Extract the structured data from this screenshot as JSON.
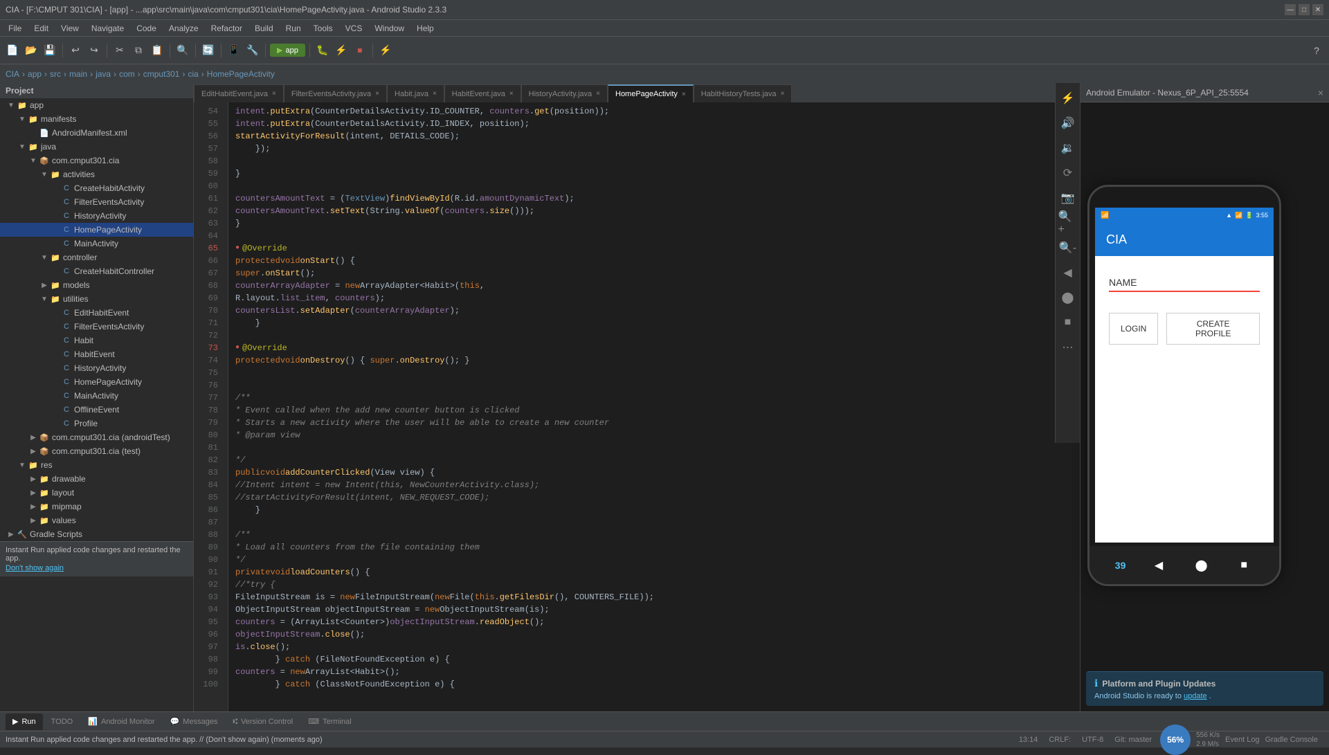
{
  "titleBar": {
    "text": "CIA - [F:\\CMPUT 301\\CIA] - [app] - ...app\\src\\main\\java\\com\\cmput301\\cia\\HomePageActivity.java - Android Studio 2.3.3",
    "minimize": "—",
    "maximize": "□",
    "close": "✕"
  },
  "menuBar": {
    "items": [
      "File",
      "Edit",
      "View",
      "Navigate",
      "Code",
      "Analyze",
      "Refactor",
      "Build",
      "Run",
      "Tools",
      "VCS",
      "Window",
      "Help"
    ]
  },
  "navBreadcrumb": {
    "items": [
      "CIA",
      "app",
      "src",
      "main",
      "java",
      "com",
      "cmput301",
      "cia",
      "HomePageActivity"
    ]
  },
  "sidebar": {
    "title": "Project",
    "items": [
      {
        "label": "app",
        "indent": 0,
        "type": "folder",
        "expanded": true
      },
      {
        "label": "manifests",
        "indent": 1,
        "type": "folder",
        "expanded": true
      },
      {
        "label": "AndroidManifest.xml",
        "indent": 2,
        "type": "manifest"
      },
      {
        "label": "java",
        "indent": 1,
        "type": "folder",
        "expanded": true
      },
      {
        "label": "com.cmput301.cia",
        "indent": 2,
        "type": "folder",
        "expanded": true
      },
      {
        "label": "activities",
        "indent": 3,
        "type": "folder",
        "expanded": true
      },
      {
        "label": "CreateHabitActivity",
        "indent": 4,
        "type": "java"
      },
      {
        "label": "FilterEventsActivity",
        "indent": 4,
        "type": "java"
      },
      {
        "label": "HistoryActivity",
        "indent": 4,
        "type": "java"
      },
      {
        "label": "HomePageActivity",
        "indent": 4,
        "type": "java",
        "selected": true
      },
      {
        "label": "MainActivity",
        "indent": 4,
        "type": "java"
      },
      {
        "label": "controller",
        "indent": 3,
        "type": "folder",
        "expanded": true
      },
      {
        "label": "CreateHabitController",
        "indent": 4,
        "type": "java"
      },
      {
        "label": "models",
        "indent": 3,
        "type": "folder"
      },
      {
        "label": "utilities",
        "indent": 3,
        "type": "folder",
        "expanded": true
      },
      {
        "label": "EditHabitEvent",
        "indent": 4,
        "type": "java"
      },
      {
        "label": "FilterEventsActivity",
        "indent": 4,
        "type": "java"
      },
      {
        "label": "Habit",
        "indent": 4,
        "type": "java"
      },
      {
        "label": "HabitEvent",
        "indent": 4,
        "type": "java"
      },
      {
        "label": "HistoryActivity",
        "indent": 4,
        "type": "java"
      },
      {
        "label": "HomePageActivity",
        "indent": 4,
        "type": "java"
      },
      {
        "label": "MainActivity",
        "indent": 4,
        "type": "java"
      },
      {
        "label": "OfflineEvent",
        "indent": 4,
        "type": "java"
      },
      {
        "label": "Profile",
        "indent": 4,
        "type": "java"
      },
      {
        "label": "com.cmput301.cia (androidTest)",
        "indent": 2,
        "type": "folder"
      },
      {
        "label": "com.cmput301.cia (test)",
        "indent": 2,
        "type": "folder"
      },
      {
        "label": "res",
        "indent": 1,
        "type": "folder",
        "expanded": true
      },
      {
        "label": "drawable",
        "indent": 2,
        "type": "folder"
      },
      {
        "label": "layout",
        "indent": 2,
        "type": "folder"
      },
      {
        "label": "mipmap",
        "indent": 2,
        "type": "folder"
      },
      {
        "label": "values",
        "indent": 2,
        "type": "folder"
      },
      {
        "label": "Gradle Scripts",
        "indent": 0,
        "type": "gradle"
      }
    ]
  },
  "tabs": [
    {
      "label": "EditHabitEvent.java",
      "active": false
    },
    {
      "label": "FilterEventsActivity.java",
      "active": false
    },
    {
      "label": "Habit.java",
      "active": false
    },
    {
      "label": "HabitEvent.java",
      "active": false
    },
    {
      "label": "HistoryActivity.java",
      "active": false
    },
    {
      "label": "HomePageActivity",
      "active": true
    },
    {
      "label": "HabitHistoryTests.java",
      "active": false
    }
  ],
  "editor": {
    "filename": "HomePageActivity",
    "lines": [
      {
        "num": 54,
        "content": "        intent.putExtra(CounterDetailsActivity.ID_COUNTER, counters.get(position));",
        "type": "code"
      },
      {
        "num": 55,
        "content": "        intent.putExtra(CounterDetailsActivity.ID_INDEX, position);",
        "type": "code"
      },
      {
        "num": 56,
        "content": "        startActivityForResult(intent, DETAILS_CODE);",
        "type": "code"
      },
      {
        "num": 57,
        "content": "    });",
        "type": "code"
      },
      {
        "num": 58,
        "content": "",
        "type": "code"
      },
      {
        "num": 59,
        "content": "}",
        "type": "code"
      },
      {
        "num": 60,
        "content": "",
        "type": "code"
      },
      {
        "num": 61,
        "content": "    countersAmountText = (TextView)findViewById(R.id.amountDynamicText);",
        "type": "code"
      },
      {
        "num": 62,
        "content": "    countersAmountText.setText(String.valueOf(counters.size()));",
        "type": "code"
      },
      {
        "num": 63,
        "content": "}",
        "type": "code"
      },
      {
        "num": 64,
        "content": "",
        "type": "code"
      },
      {
        "num": 65,
        "content": "    @Override",
        "type": "annotation",
        "hasBreakpoint": true
      },
      {
        "num": 66,
        "content": "    protected void onStart() {",
        "type": "code"
      },
      {
        "num": 67,
        "content": "        super.onStart();",
        "type": "code"
      },
      {
        "num": 68,
        "content": "        counterArrayAdapter = new ArrayAdapter<Habit>(this,",
        "type": "code"
      },
      {
        "num": 69,
        "content": "                R.layout.list_item, counters);",
        "type": "code"
      },
      {
        "num": 70,
        "content": "        countersList.setAdapter(counterArrayAdapter);",
        "type": "code"
      },
      {
        "num": 71,
        "content": "    }",
        "type": "code"
      },
      {
        "num": 72,
        "content": "",
        "type": "code"
      },
      {
        "num": 73,
        "content": "    @Override",
        "type": "annotation",
        "hasBreakpoint": true
      },
      {
        "num": 74,
        "content": "    protected void onDestroy() { super.onDestroy(); }",
        "type": "code"
      },
      {
        "num": 75,
        "content": "",
        "type": "code"
      },
      {
        "num": 76,
        "content": "",
        "type": "code"
      },
      {
        "num": 77,
        "content": "    /**",
        "type": "comment"
      },
      {
        "num": 78,
        "content": "     * Event called when the add new counter button is clicked",
        "type": "comment"
      },
      {
        "num": 79,
        "content": "     * Starts a new activity where the user will be able to create a new counter",
        "type": "comment"
      },
      {
        "num": 80,
        "content": "     * @param view",
        "type": "comment"
      },
      {
        "num": 81,
        "content": "",
        "type": "code"
      },
      {
        "num": 82,
        "content": "     */",
        "type": "comment"
      },
      {
        "num": 83,
        "content": "    public void addCounterClicked(View view) {",
        "type": "code"
      },
      {
        "num": 84,
        "content": "        //Intent intent = new Intent(this, NewCounterActivity.class);",
        "type": "comment"
      },
      {
        "num": 85,
        "content": "        //startActivityForResult(intent, NEW_REQUEST_CODE);",
        "type": "comment"
      },
      {
        "num": 86,
        "content": "    }",
        "type": "code"
      },
      {
        "num": 87,
        "content": "",
        "type": "code"
      },
      {
        "num": 88,
        "content": "    /**",
        "type": "comment"
      },
      {
        "num": 89,
        "content": "     * Load all counters from the file containing them",
        "type": "comment"
      },
      {
        "num": 90,
        "content": "     */",
        "type": "comment"
      },
      {
        "num": 91,
        "content": "    private void loadCounters() {",
        "type": "code"
      },
      {
        "num": 92,
        "content": "        //*try {",
        "type": "comment"
      },
      {
        "num": 93,
        "content": "            FileInputStream is = new FileInputStream(new File(this.getFilesDir(), COUNTERS_FILE));",
        "type": "code"
      },
      {
        "num": 94,
        "content": "            ObjectInputStream objectInputStream = new ObjectInputStream(is);",
        "type": "code"
      },
      {
        "num": 95,
        "content": "            counters = (ArrayList<Counter>)objectInputStream.readObject();",
        "type": "code"
      },
      {
        "num": 96,
        "content": "            objectInputStream.close();",
        "type": "code"
      },
      {
        "num": 97,
        "content": "            is.close();",
        "type": "code"
      },
      {
        "num": 98,
        "content": "        } catch (FileNotFoundException e) {",
        "type": "code"
      },
      {
        "num": 99,
        "content": "            counters = new ArrayList<Habit>();",
        "type": "code"
      },
      {
        "num": 100,
        "content": "        } catch (ClassNotFoundException e) {",
        "type": "code"
      }
    ]
  },
  "emulator": {
    "title": "Android Emulator - Nexus_6P_API_25:5554",
    "phone": {
      "time": "3:55",
      "appTitle": "CIA",
      "nameLabel": "NAME",
      "loginBtn": "LOGIN",
      "createProfileBtn": "CREATE PROFILE",
      "bottomNumber": "39"
    }
  },
  "bottomTabs": [
    {
      "label": "Run",
      "icon": "▶"
    },
    {
      "label": "TODO",
      "icon": ""
    },
    {
      "label": "Android Monitor",
      "icon": ""
    },
    {
      "label": "Messages",
      "icon": ""
    },
    {
      "label": "Version Control",
      "icon": ""
    },
    {
      "label": "Terminal",
      "icon": ""
    }
  ],
  "statusBar": {
    "message": "Instant Run applied code changes and restarted the app. // (Don't show again) (moments ago)",
    "position": "13:14",
    "encoding": "CRLF:",
    "separator": "UTF-8"
  },
  "notification": {
    "icon": "ℹ",
    "title": "Platform and Plugin Updates",
    "message": "Android Studio is ready to",
    "linkText": "update"
  },
  "cpuMeter": {
    "value": "56%"
  },
  "instantRun": {
    "message": "Instant Run applied code changes and restarted the app.",
    "link": "Don't show again"
  }
}
